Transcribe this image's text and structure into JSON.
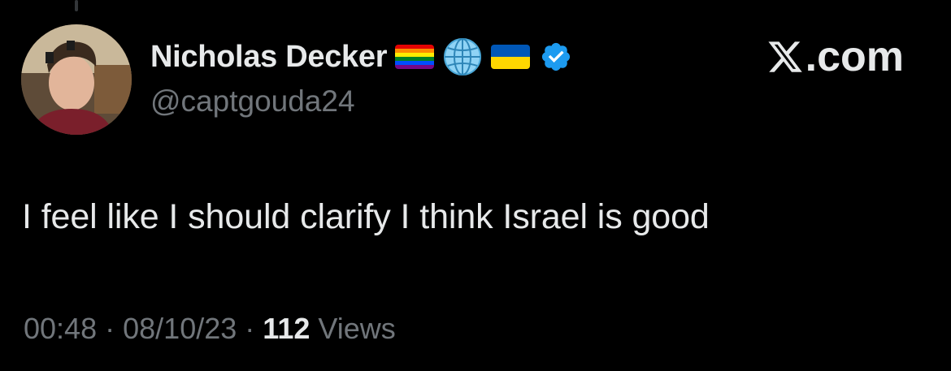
{
  "header": {
    "display_name": "Nicholas Decker",
    "handle": "@captgouda24",
    "name_icons": [
      "rainbow-flag-icon",
      "globe-icon",
      "ukraine-flag-icon",
      "verified-badge-icon"
    ],
    "brand_text": ".com",
    "brand_logo": "x-logo-icon"
  },
  "tweet": {
    "text": "I feel like I should clarify I think Israel is good"
  },
  "meta": {
    "time": "00:48",
    "separator": "·",
    "date": "08/10/23",
    "views_count": "112",
    "views_label": "Views"
  },
  "colors": {
    "background": "#000000",
    "primary_text": "#e7e9ea",
    "secondary_text": "#71767b",
    "verified": "#1d9bf0"
  }
}
